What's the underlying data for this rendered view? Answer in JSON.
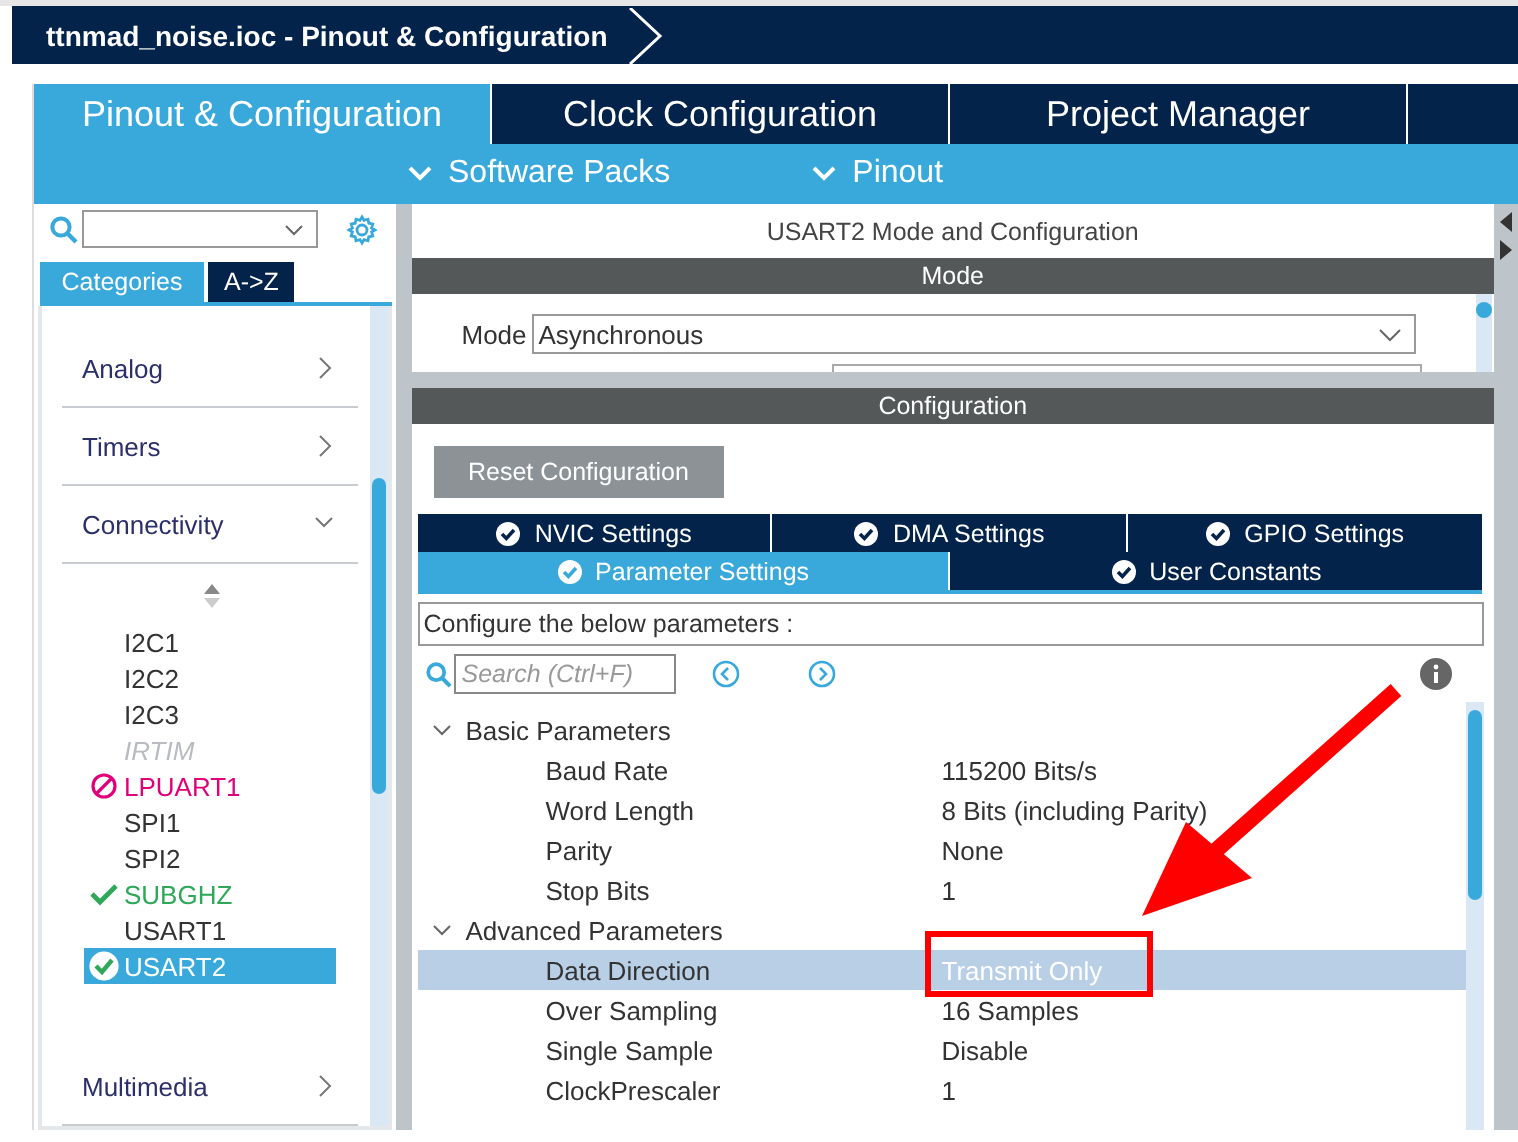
{
  "breadcrumb": {
    "title": "ttnmad_noise.ioc - Pinout & Configuration"
  },
  "main_tabs": [
    {
      "label": "Pinout & Configuration",
      "selected": true
    },
    {
      "label": "Clock Configuration",
      "selected": false
    },
    {
      "label": "Project Manager",
      "selected": false
    }
  ],
  "sub_menu": [
    "Software Packs",
    "Pinout"
  ],
  "sidebar": {
    "view_tabs": [
      {
        "label": "Categories",
        "selected": true
      },
      {
        "label": "A->Z",
        "selected": false
      }
    ],
    "categories": [
      {
        "label": "Analog",
        "expanded": false
      },
      {
        "label": "Timers",
        "expanded": false
      },
      {
        "label": "Connectivity",
        "expanded": true,
        "children": [
          {
            "label": "I2C1",
            "disabled": false,
            "conflict": false,
            "configured": false,
            "selected": false
          },
          {
            "label": "I2C2",
            "disabled": false,
            "conflict": false,
            "configured": false,
            "selected": false
          },
          {
            "label": "I2C3",
            "disabled": false,
            "conflict": false,
            "configured": false,
            "selected": false
          },
          {
            "label": "IRTIM",
            "disabled": true,
            "conflict": false,
            "configured": false,
            "selected": false
          },
          {
            "label": "LPUART1",
            "disabled": false,
            "conflict": true,
            "configured": false,
            "selected": false
          },
          {
            "label": "SPI1",
            "disabled": false,
            "conflict": false,
            "configured": false,
            "selected": false
          },
          {
            "label": "SPI2",
            "disabled": false,
            "conflict": false,
            "configured": false,
            "selected": false
          },
          {
            "label": "SUBGHZ",
            "disabled": false,
            "conflict": false,
            "configured": true,
            "selected": false
          },
          {
            "label": "USART1",
            "disabled": false,
            "conflict": false,
            "configured": false,
            "selected": false
          },
          {
            "label": "USART2",
            "disabled": false,
            "conflict": false,
            "configured": true,
            "selected": true
          }
        ]
      },
      {
        "label": "Multimedia",
        "expanded": false
      }
    ]
  },
  "panel": {
    "title": "USART2 Mode and Configuration",
    "mode": {
      "header": "Mode",
      "label": "Mode",
      "value": "Asynchronous"
    },
    "configuration": {
      "header": "Configuration",
      "reset_button": "Reset Configuration",
      "tab_rows": [
        {
          "tabs": [
            {
              "label": "NVIC Settings",
              "selected": false
            },
            {
              "label": "DMA Settings",
              "selected": false
            },
            {
              "label": "GPIO Settings",
              "selected": false
            }
          ]
        },
        {
          "tabs": [
            {
              "label": "Parameter Settings",
              "selected": true
            },
            {
              "label": "User Constants",
              "selected": false
            }
          ]
        }
      ],
      "hint": "Configure the below parameters :",
      "search": {
        "placeholder": "Search (Ctrl+F)"
      },
      "groups": [
        {
          "label": "Basic Parameters",
          "expanded": true,
          "children": [
            {
              "name": "Baud Rate",
              "value": "115200 Bits/s",
              "selected": false
            },
            {
              "name": "Word Length",
              "value": "8 Bits (including Parity)",
              "selected": false
            },
            {
              "name": "Parity",
              "value": "None",
              "selected": false
            },
            {
              "name": "Stop Bits",
              "value": "1",
              "selected": false
            }
          ]
        },
        {
          "label": "Advanced Parameters",
          "expanded": true,
          "children": [
            {
              "name": "Data Direction",
              "value": "Transmit Only",
              "selected": true
            },
            {
              "name": "Over Sampling",
              "value": "16 Samples",
              "selected": false
            },
            {
              "name": "Single Sample",
              "value": "Disable",
              "selected": false
            },
            {
              "name": "ClockPrescaler",
              "value": "1",
              "selected": false
            }
          ]
        }
      ]
    }
  }
}
